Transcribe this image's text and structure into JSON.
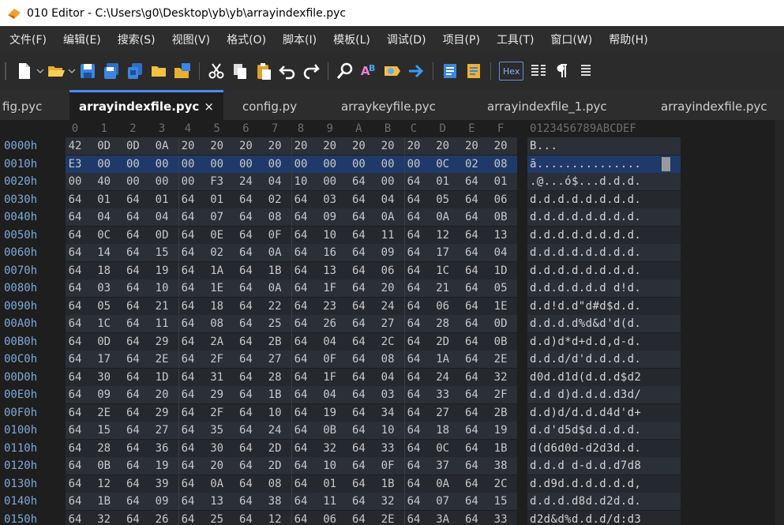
{
  "window": {
    "title": "010 Editor - C:\\Users\\g0\\Desktop\\yb\\yb\\arrayindexfile.pyc"
  },
  "menu": [
    {
      "label": "文件(F)"
    },
    {
      "label": "编辑(E)"
    },
    {
      "label": "搜索(S)"
    },
    {
      "label": "视图(V)"
    },
    {
      "label": "格式(O)"
    },
    {
      "label": "脚本(I)"
    },
    {
      "label": "模板(L)"
    },
    {
      "label": "调试(D)"
    },
    {
      "label": "项目(P)"
    },
    {
      "label": "工具(T)"
    },
    {
      "label": "窗口(W)"
    },
    {
      "label": "帮助(H)"
    }
  ],
  "toolbar": {
    "icons": [
      "new-file-icon",
      "open-folder-icon",
      "save-icon",
      "save-all-icon",
      "copy-file-icon",
      "folder-icon",
      "open-workspace-icon",
      "cut-icon",
      "copy-icon",
      "paste-icon",
      "undo-icon",
      "redo-icon",
      "find-icon",
      "replace-icon",
      "find-in-files-icon",
      "goto-icon",
      "run-script-icon",
      "run-template-icon",
      "hex-mode-icon",
      "columns-icon",
      "pilcrow-icon",
      "more-icon"
    ],
    "hex_label": "Hex"
  },
  "tabs": [
    {
      "label": "fig.pyc",
      "active": false
    },
    {
      "label": "arrayindexfile.pyc",
      "active": true
    },
    {
      "label": "config.py",
      "active": false
    },
    {
      "label": "arraykeyfile.pyc",
      "active": false
    },
    {
      "label": "arrayindexfile_1.pyc",
      "active": false
    },
    {
      "label": "arrayindexfile.pyc",
      "active": false
    }
  ],
  "tab_close_glyph": "×",
  "hex": {
    "header_cols": [
      "0",
      "1",
      "2",
      "3",
      "4",
      "5",
      "6",
      "7",
      "8",
      "9",
      "A",
      "B",
      "C",
      "D",
      "E",
      "F"
    ],
    "header_ascii": "0123456789ABCDEF",
    "selected_row": 1,
    "rows": [
      {
        "addr": "0000h",
        "bytes": [
          "42",
          "0D",
          "0D",
          "0A",
          "20",
          "20",
          "20",
          "20",
          "20",
          "20",
          "20",
          "20",
          "20",
          "20",
          "20",
          "20"
        ],
        "ascii": "B..."
      },
      {
        "addr": "0010h",
        "bytes": [
          "E3",
          "00",
          "00",
          "00",
          "00",
          "00",
          "00",
          "00",
          "00",
          "00",
          "00",
          "00",
          "00",
          "0C",
          "02",
          "08"
        ],
        "ascii": "ã..............."
      },
      {
        "addr": "0020h",
        "bytes": [
          "00",
          "40",
          "00",
          "00",
          "00",
          "F3",
          "24",
          "04",
          "10",
          "00",
          "64",
          "00",
          "64",
          "01",
          "64",
          "01"
        ],
        "ascii": ".@...ó$...d.d.d."
      },
      {
        "addr": "0030h",
        "bytes": [
          "64",
          "01",
          "64",
          "01",
          "64",
          "01",
          "64",
          "02",
          "64",
          "03",
          "64",
          "04",
          "64",
          "05",
          "64",
          "06"
        ],
        "ascii": "d.d.d.d.d.d.d.d."
      },
      {
        "addr": "0040h",
        "bytes": [
          "64",
          "04",
          "64",
          "04",
          "64",
          "07",
          "64",
          "08",
          "64",
          "09",
          "64",
          "0A",
          "64",
          "0A",
          "64",
          "0B"
        ],
        "ascii": "d.d.d.d.d.d.d.d."
      },
      {
        "addr": "0050h",
        "bytes": [
          "64",
          "0C",
          "64",
          "0D",
          "64",
          "0E",
          "64",
          "0F",
          "64",
          "10",
          "64",
          "11",
          "64",
          "12",
          "64",
          "13"
        ],
        "ascii": "d.d.d.d.d.d.d.d."
      },
      {
        "addr": "0060h",
        "bytes": [
          "64",
          "14",
          "64",
          "15",
          "64",
          "02",
          "64",
          "0A",
          "64",
          "16",
          "64",
          "09",
          "64",
          "17",
          "64",
          "04"
        ],
        "ascii": "d.d.d.d.d.d.d.d."
      },
      {
        "addr": "0070h",
        "bytes": [
          "64",
          "18",
          "64",
          "19",
          "64",
          "1A",
          "64",
          "1B",
          "64",
          "13",
          "64",
          "06",
          "64",
          "1C",
          "64",
          "1D"
        ],
        "ascii": "d.d.d.d.d.d.d.d."
      },
      {
        "addr": "0080h",
        "bytes": [
          "64",
          "03",
          "64",
          "10",
          "64",
          "1E",
          "64",
          "0A",
          "64",
          "1F",
          "64",
          "20",
          "64",
          "21",
          "64",
          "05"
        ],
        "ascii": "d.d.d.d.d.d d!d."
      },
      {
        "addr": "0090h",
        "bytes": [
          "64",
          "05",
          "64",
          "21",
          "64",
          "18",
          "64",
          "22",
          "64",
          "23",
          "64",
          "24",
          "64",
          "06",
          "64",
          "1E"
        ],
        "ascii": "d.d!d.d\"d#d$d.d."
      },
      {
        "addr": "00A0h",
        "bytes": [
          "64",
          "1C",
          "64",
          "11",
          "64",
          "08",
          "64",
          "25",
          "64",
          "26",
          "64",
          "27",
          "64",
          "28",
          "64",
          "0D"
        ],
        "ascii": "d.d.d.d%d&d'd(d."
      },
      {
        "addr": "00B0h",
        "bytes": [
          "64",
          "0D",
          "64",
          "29",
          "64",
          "2A",
          "64",
          "2B",
          "64",
          "04",
          "64",
          "2C",
          "64",
          "2D",
          "64",
          "0B"
        ],
        "ascii": "d.d)d*d+d.d,d-d."
      },
      {
        "addr": "00C0h",
        "bytes": [
          "64",
          "17",
          "64",
          "2E",
          "64",
          "2F",
          "64",
          "27",
          "64",
          "0F",
          "64",
          "08",
          "64",
          "1A",
          "64",
          "2E"
        ],
        "ascii": "d.d.d/d'd.d.d.d."
      },
      {
        "addr": "00D0h",
        "bytes": [
          "64",
          "30",
          "64",
          "1D",
          "64",
          "31",
          "64",
          "28",
          "64",
          "1F",
          "64",
          "04",
          "64",
          "24",
          "64",
          "32"
        ],
        "ascii": "d0d.d1d(d.d.d$d2"
      },
      {
        "addr": "00E0h",
        "bytes": [
          "64",
          "09",
          "64",
          "20",
          "64",
          "29",
          "64",
          "1B",
          "64",
          "04",
          "64",
          "03",
          "64",
          "33",
          "64",
          "2F"
        ],
        "ascii": "d.d d)d.d.d.d3d/"
      },
      {
        "addr": "00F0h",
        "bytes": [
          "64",
          "2E",
          "64",
          "29",
          "64",
          "2F",
          "64",
          "10",
          "64",
          "19",
          "64",
          "34",
          "64",
          "27",
          "64",
          "2B"
        ],
        "ascii": "d.d)d/d.d.d4d'd+"
      },
      {
        "addr": "0100h",
        "bytes": [
          "64",
          "15",
          "64",
          "27",
          "64",
          "35",
          "64",
          "24",
          "64",
          "0B",
          "64",
          "10",
          "64",
          "18",
          "64",
          "19"
        ],
        "ascii": "d.d'd5d$d.d.d.d."
      },
      {
        "addr": "0110h",
        "bytes": [
          "64",
          "28",
          "64",
          "36",
          "64",
          "30",
          "64",
          "2D",
          "64",
          "32",
          "64",
          "33",
          "64",
          "0C",
          "64",
          "1B"
        ],
        "ascii": "d(d6d0d-d2d3d.d."
      },
      {
        "addr": "0120h",
        "bytes": [
          "64",
          "0B",
          "64",
          "19",
          "64",
          "20",
          "64",
          "2D",
          "64",
          "10",
          "64",
          "0F",
          "64",
          "37",
          "64",
          "38"
        ],
        "ascii": "d.d.d d-d.d.d7d8"
      },
      {
        "addr": "0130h",
        "bytes": [
          "64",
          "12",
          "64",
          "39",
          "64",
          "0A",
          "64",
          "08",
          "64",
          "01",
          "64",
          "1B",
          "64",
          "0A",
          "64",
          "2C"
        ],
        "ascii": "d.d9d.d.d.d.d.d,"
      },
      {
        "addr": "0140h",
        "bytes": [
          "64",
          "1B",
          "64",
          "09",
          "64",
          "13",
          "64",
          "38",
          "64",
          "11",
          "64",
          "32",
          "64",
          "07",
          "64",
          "15"
        ],
        "ascii": "d.d.d.d8d.d2d.d."
      },
      {
        "addr": "0150h",
        "bytes": [
          "64",
          "32",
          "64",
          "26",
          "64",
          "25",
          "64",
          "12",
          "64",
          "06",
          "64",
          "2E",
          "64",
          "3A",
          "64",
          "33"
        ],
        "ascii": "d2d&d%d.d.d/d:d3"
      }
    ]
  },
  "colors": {
    "editor_bg": "#1e1e1e",
    "selection": "#1f3a6a",
    "address": "#7fa8d8",
    "tab_active_accent": "#4a8cf0"
  }
}
